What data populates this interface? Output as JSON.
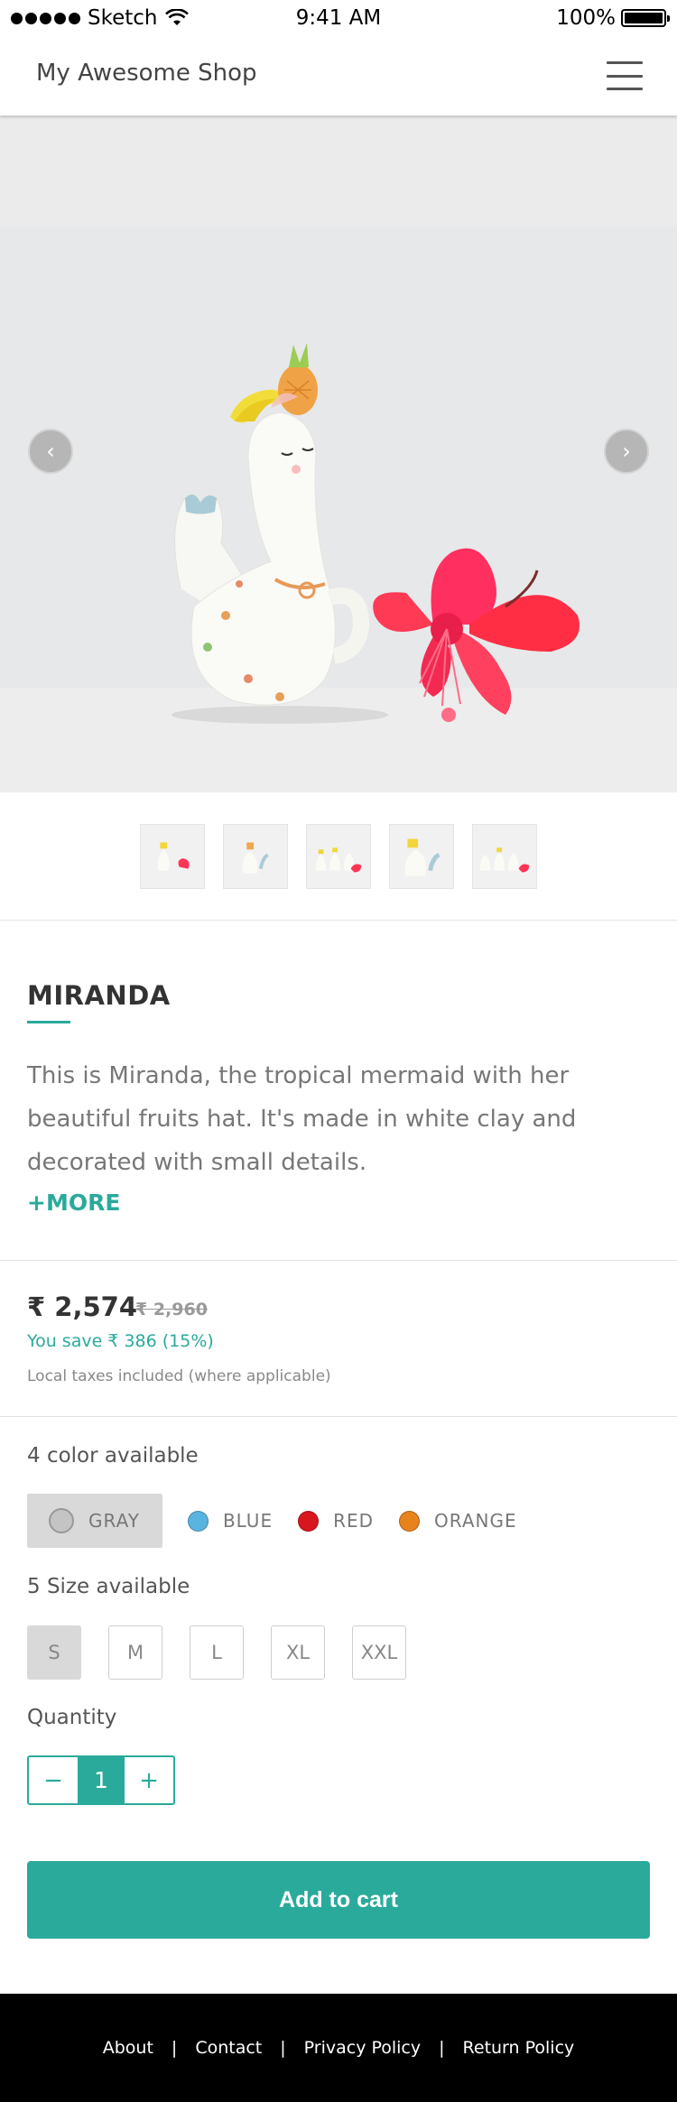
{
  "status_bar": {
    "carrier": "Sketch",
    "time": "9:41 AM",
    "battery": "100%"
  },
  "header": {
    "shop_name": "My Awesome Shop",
    "menu_icon": "hamburger-menu-icon"
  },
  "carousel": {
    "prev_icon": "chevron-left-icon",
    "next_icon": "chevron-right-icon",
    "prev_glyph": "‹",
    "next_glyph": "›",
    "thumbnail_count": 5
  },
  "product": {
    "name": "MIRANDA",
    "description": "This is Miranda, the tropical mermaid with her beautiful fruits hat. It's made in white clay and decorated with small details.",
    "more_label": "+MORE",
    "price": "₹ 2,574",
    "original_price": "₹ 2,960",
    "savings": "You save ₹ 386 (15%)",
    "tax_note": "Local taxes included (where applicable)"
  },
  "colors": {
    "label": "4 color available",
    "options": [
      {
        "name": "GRAY",
        "hex": "#c4c4c4",
        "selected": true
      },
      {
        "name": "BLUE",
        "hex": "#5ab4e0",
        "selected": false
      },
      {
        "name": "RED",
        "hex": "#d7161e",
        "selected": false
      },
      {
        "name": "ORANGE",
        "hex": "#e8821c",
        "selected": false
      }
    ]
  },
  "sizes": {
    "label": "5 Size available",
    "options": [
      "S",
      "M",
      "L",
      "XL",
      "XXL"
    ],
    "selected": "S"
  },
  "quantity": {
    "label": "Quantity",
    "value": "1",
    "minus": "−",
    "plus": "+"
  },
  "cart": {
    "button_label": "Add to cart"
  },
  "footer": {
    "links": [
      "About",
      "Contact",
      "Privacy Policy",
      "Return Policy"
    ],
    "separator": "|"
  },
  "theme": {
    "accent": "#2aaa9b",
    "footer_bg": "#000000"
  }
}
